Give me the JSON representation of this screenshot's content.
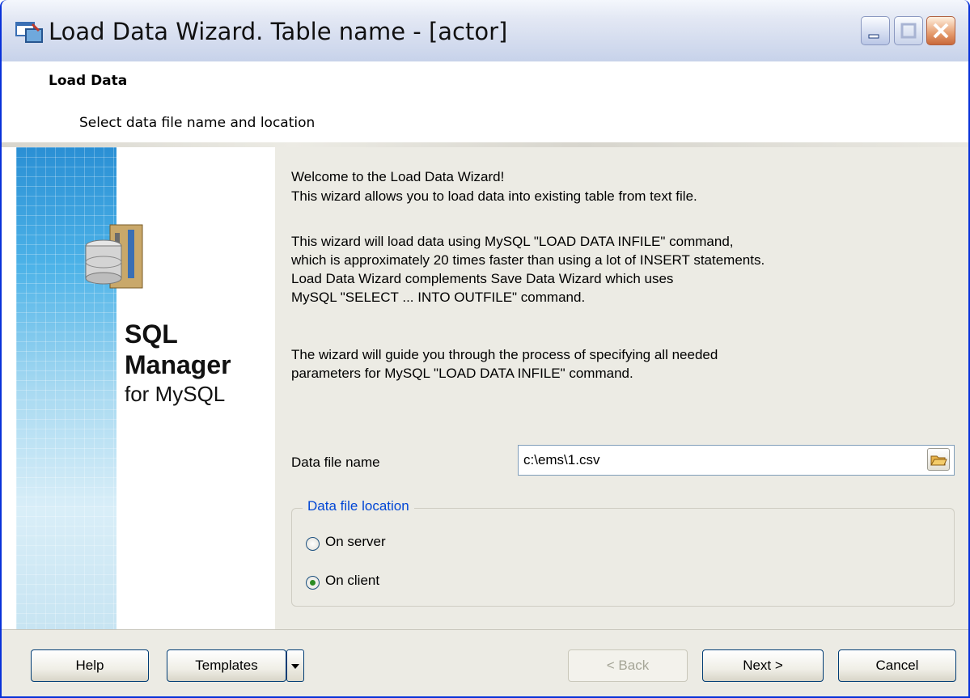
{
  "window": {
    "title": "Load Data Wizard. Table name - [actor]",
    "icon": "wizard-icon"
  },
  "header": {
    "title": "Load Data",
    "subtitle": "Select data file name and location"
  },
  "brand": {
    "line1": "SQL",
    "line2": "Manager",
    "line3": "for MySQL"
  },
  "content": {
    "welcome": "Welcome to the Load Data Wizard!",
    "intro": "This wizard allows you to load data into existing table from text file.",
    "p2_l1": "This wizard will load data using MySQL \"LOAD DATA INFILE\" command,",
    "p2_l2": "which is approximately 20 times faster than using a lot of INSERT statements.",
    "p2_l3": "Load Data Wizard complements Save Data Wizard which uses",
    "p2_l4": "MySQL  \"SELECT ... INTO OUTFILE\" command.",
    "p3_l1": "The wizard will guide you through the process of specifying all needed",
    "p3_l2": "parameters for MySQL \"LOAD DATA INFILE\" command.",
    "file_label": "Data file name",
    "file_value": "c:\\ems\\1.csv",
    "location_legend": "Data file location",
    "option_server": "On server",
    "option_client": "On client",
    "selected_option": "On client"
  },
  "footer": {
    "help": "Help",
    "templates": "Templates",
    "back": "< Back",
    "next": "Next >",
    "cancel": "Cancel"
  }
}
